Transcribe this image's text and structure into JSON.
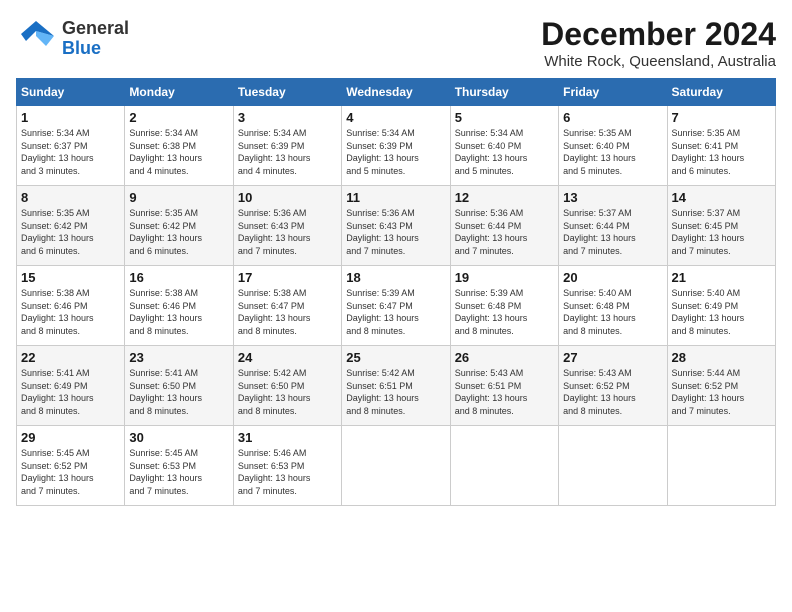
{
  "header": {
    "logo_general": "General",
    "logo_blue": "Blue",
    "month_title": "December 2024",
    "location": "White Rock, Queensland, Australia"
  },
  "calendar": {
    "days_of_week": [
      "Sunday",
      "Monday",
      "Tuesday",
      "Wednesday",
      "Thursday",
      "Friday",
      "Saturday"
    ],
    "weeks": [
      [
        {
          "day": "",
          "info": ""
        },
        {
          "day": "2",
          "info": "Sunrise: 5:34 AM\nSunset: 6:38 PM\nDaylight: 13 hours\nand 4 minutes."
        },
        {
          "day": "3",
          "info": "Sunrise: 5:34 AM\nSunset: 6:39 PM\nDaylight: 13 hours\nand 4 minutes."
        },
        {
          "day": "4",
          "info": "Sunrise: 5:34 AM\nSunset: 6:39 PM\nDaylight: 13 hours\nand 5 minutes."
        },
        {
          "day": "5",
          "info": "Sunrise: 5:34 AM\nSunset: 6:40 PM\nDaylight: 13 hours\nand 5 minutes."
        },
        {
          "day": "6",
          "info": "Sunrise: 5:35 AM\nSunset: 6:40 PM\nDaylight: 13 hours\nand 5 minutes."
        },
        {
          "day": "7",
          "info": "Sunrise: 5:35 AM\nSunset: 6:41 PM\nDaylight: 13 hours\nand 6 minutes."
        }
      ],
      [
        {
          "day": "1",
          "info": "Sunrise: 5:34 AM\nSunset: 6:37 PM\nDaylight: 13 hours\nand 3 minutes."
        },
        {
          "day": "9",
          "info": "Sunrise: 5:35 AM\nSunset: 6:42 PM\nDaylight: 13 hours\nand 6 minutes."
        },
        {
          "day": "10",
          "info": "Sunrise: 5:36 AM\nSunset: 6:43 PM\nDaylight: 13 hours\nand 7 minutes."
        },
        {
          "day": "11",
          "info": "Sunrise: 5:36 AM\nSunset: 6:43 PM\nDaylight: 13 hours\nand 7 minutes."
        },
        {
          "day": "12",
          "info": "Sunrise: 5:36 AM\nSunset: 6:44 PM\nDaylight: 13 hours\nand 7 minutes."
        },
        {
          "day": "13",
          "info": "Sunrise: 5:37 AM\nSunset: 6:44 PM\nDaylight: 13 hours\nand 7 minutes."
        },
        {
          "day": "14",
          "info": "Sunrise: 5:37 AM\nSunset: 6:45 PM\nDaylight: 13 hours\nand 7 minutes."
        }
      ],
      [
        {
          "day": "8",
          "info": "Sunrise: 5:35 AM\nSunset: 6:42 PM\nDaylight: 13 hours\nand 6 minutes."
        },
        {
          "day": "16",
          "info": "Sunrise: 5:38 AM\nSunset: 6:46 PM\nDaylight: 13 hours\nand 8 minutes."
        },
        {
          "day": "17",
          "info": "Sunrise: 5:38 AM\nSunset: 6:47 PM\nDaylight: 13 hours\nand 8 minutes."
        },
        {
          "day": "18",
          "info": "Sunrise: 5:39 AM\nSunset: 6:47 PM\nDaylight: 13 hours\nand 8 minutes."
        },
        {
          "day": "19",
          "info": "Sunrise: 5:39 AM\nSunset: 6:48 PM\nDaylight: 13 hours\nand 8 minutes."
        },
        {
          "day": "20",
          "info": "Sunrise: 5:40 AM\nSunset: 6:48 PM\nDaylight: 13 hours\nand 8 minutes."
        },
        {
          "day": "21",
          "info": "Sunrise: 5:40 AM\nSunset: 6:49 PM\nDaylight: 13 hours\nand 8 minutes."
        }
      ],
      [
        {
          "day": "15",
          "info": "Sunrise: 5:38 AM\nSunset: 6:46 PM\nDaylight: 13 hours\nand 8 minutes."
        },
        {
          "day": "23",
          "info": "Sunrise: 5:41 AM\nSunset: 6:50 PM\nDaylight: 13 hours\nand 8 minutes."
        },
        {
          "day": "24",
          "info": "Sunrise: 5:42 AM\nSunset: 6:50 PM\nDaylight: 13 hours\nand 8 minutes."
        },
        {
          "day": "25",
          "info": "Sunrise: 5:42 AM\nSunset: 6:51 PM\nDaylight: 13 hours\nand 8 minutes."
        },
        {
          "day": "26",
          "info": "Sunrise: 5:43 AM\nSunset: 6:51 PM\nDaylight: 13 hours\nand 8 minutes."
        },
        {
          "day": "27",
          "info": "Sunrise: 5:43 AM\nSunset: 6:52 PM\nDaylight: 13 hours\nand 8 minutes."
        },
        {
          "day": "28",
          "info": "Sunrise: 5:44 AM\nSunset: 6:52 PM\nDaylight: 13 hours\nand 7 minutes."
        }
      ],
      [
        {
          "day": "22",
          "info": "Sunrise: 5:41 AM\nSunset: 6:49 PM\nDaylight: 13 hours\nand 8 minutes."
        },
        {
          "day": "30",
          "info": "Sunrise: 5:45 AM\nSunset: 6:53 PM\nDaylight: 13 hours\nand 7 minutes."
        },
        {
          "day": "31",
          "info": "Sunrise: 5:46 AM\nSunset: 6:53 PM\nDaylight: 13 hours\nand 7 minutes."
        },
        {
          "day": "",
          "info": ""
        },
        {
          "day": "",
          "info": ""
        },
        {
          "day": "",
          "info": ""
        },
        {
          "day": "",
          "info": ""
        }
      ]
    ],
    "week5_start": [
      {
        "day": "29",
        "info": "Sunrise: 5:45 AM\nSunset: 6:52 PM\nDaylight: 13 hours\nand 7 minutes."
      }
    ]
  }
}
